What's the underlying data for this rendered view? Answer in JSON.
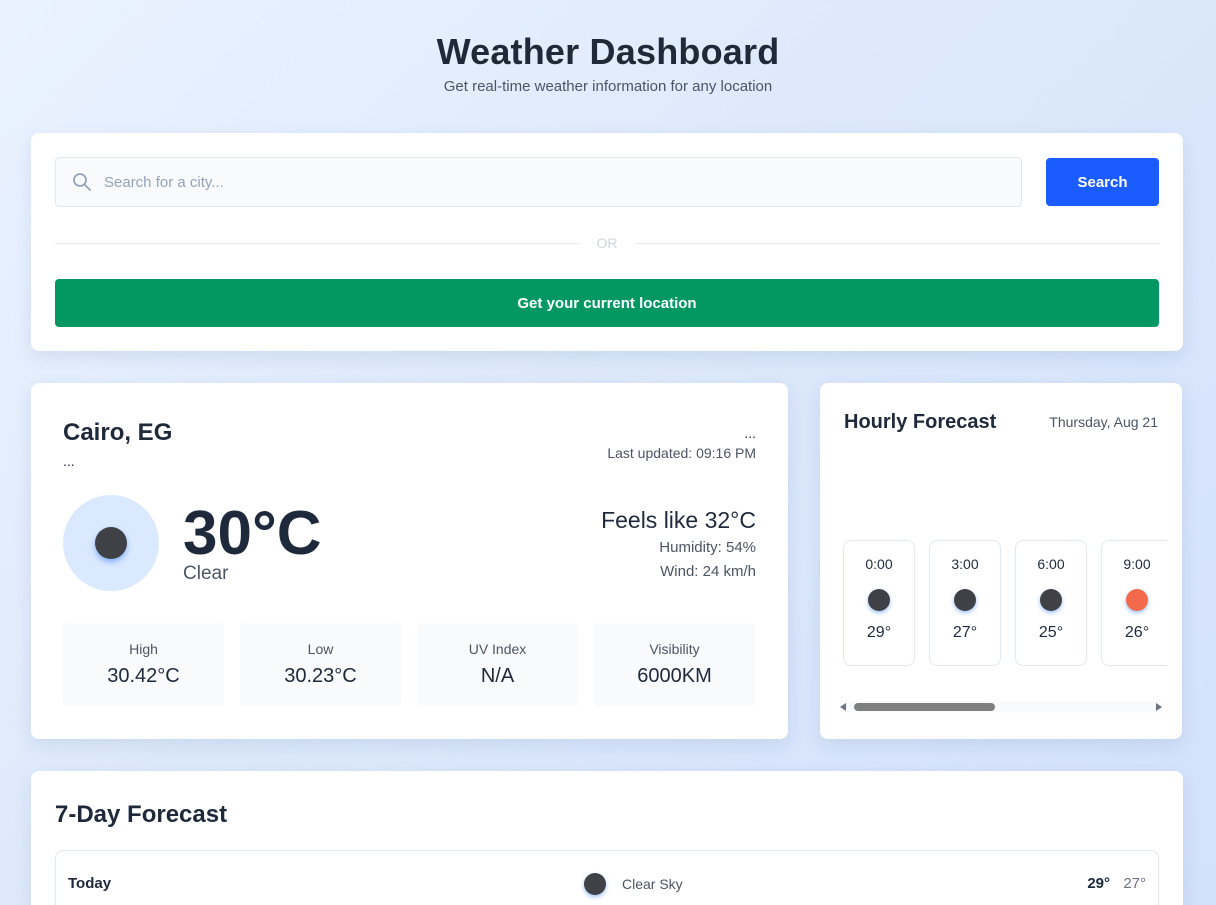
{
  "header": {
    "title": "Weather Dashboard",
    "subtitle": "Get real-time weather information for any location"
  },
  "search": {
    "placeholder": "Search for a city...",
    "button_label": "Search",
    "or_label": "OR",
    "location_button_label": "Get your current location",
    "icon": "search-icon"
  },
  "current": {
    "city": "Cairo, EG",
    "city_sub": "...",
    "updated_dots": "...",
    "last_updated": "Last updated: 09:16 PM",
    "temperature": "30°C",
    "condition": "Clear",
    "feels_like": "Feels like 32°C",
    "humidity": "Humidity: 54%",
    "wind": "Wind: 24 km/h",
    "icon": "moon-icon",
    "stats": [
      {
        "label": "High",
        "value": "30.42°C"
      },
      {
        "label": "Low",
        "value": "30.23°C"
      },
      {
        "label": "UV Index",
        "value": "N/A"
      },
      {
        "label": "Visibility",
        "value": "6000KM"
      }
    ]
  },
  "hourly": {
    "title": "Hourly Forecast",
    "date": "Thursday, Aug 21",
    "items": [
      {
        "time": "0:00",
        "temp": "29°",
        "icon": "moon-icon"
      },
      {
        "time": "3:00",
        "temp": "27°",
        "icon": "moon-icon"
      },
      {
        "time": "6:00",
        "temp": "25°",
        "icon": "moon-icon"
      },
      {
        "time": "9:00",
        "temp": "26°",
        "icon": "sun-icon"
      }
    ],
    "colors": {
      "night": "#3f4147",
      "day": "#f26a4b"
    }
  },
  "weekly": {
    "title": "7-Day Forecast",
    "days": [
      {
        "day": "Today",
        "condition": "Clear Sky",
        "high": "29°",
        "low": "27°",
        "icon": "moon-icon"
      }
    ]
  },
  "colors": {
    "primary": "#1a5cff",
    "success": "#039763"
  }
}
